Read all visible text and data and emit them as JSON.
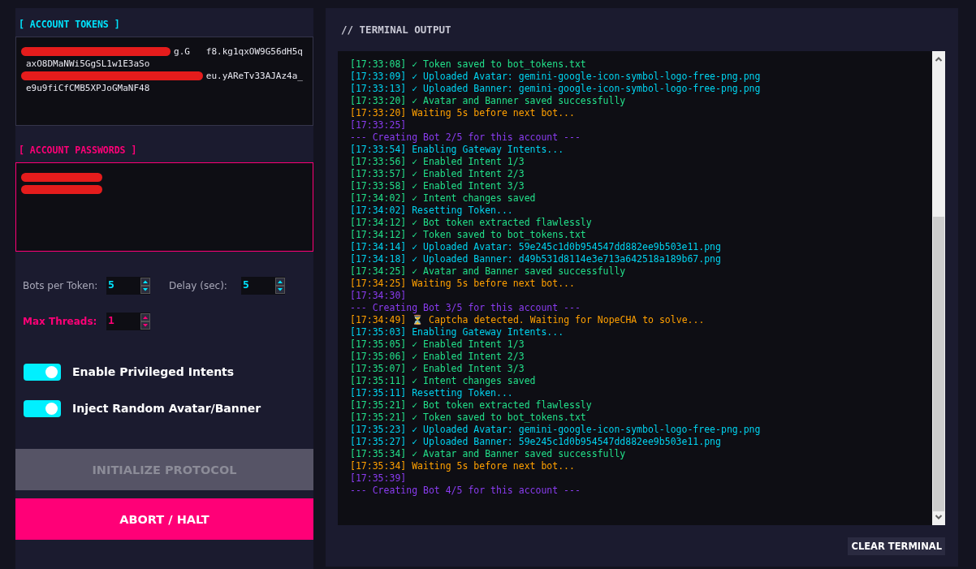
{
  "tokens": {
    "label": "[ ACCOUNT TOKENS ]",
    "lines": [
      {
        "text": "g.G   f8.kg1qxOW9G56dH5q",
        "redacted": true
      },
      {
        "text": "axO8DMaNWi5GgSL1w1E3aSo",
        "redacted": false
      },
      {
        "text": "eu.yAReTv33AJAz4a_",
        "redacted": true
      },
      {
        "text": "e9u9fiCfCMB5XPJoGMaNF48",
        "redacted": false
      }
    ]
  },
  "passwords": {
    "label": "[ ACCOUNT PASSWORDS ]",
    "lines": [
      {
        "redacted": true
      },
      {
        "redacted": true
      }
    ]
  },
  "settings": [
    {
      "label": "Bots per Token:",
      "value": "5",
      "kind": "normal"
    },
    {
      "label": "Delay (sec):",
      "value": "5",
      "kind": "normal"
    },
    {
      "label": "Max Threads:",
      "value": "1",
      "kind": "accent"
    }
  ],
  "toggles": [
    {
      "label": "Enable Privileged Intents",
      "on": true
    },
    {
      "label": "Inject Random Avatar/Banner",
      "on": true
    }
  ],
  "buttons": [
    {
      "label": "INITIALIZE PROTOCOL",
      "kind": "primary",
      "disabled": true
    },
    {
      "label": "ABORT / HALT",
      "kind": "danger",
      "disabled": false
    }
  ],
  "terminal": {
    "title": "// TERMINAL OUTPUT",
    "lines": [
      {
        "kind": "success",
        "time": "[17:33:08]",
        "icon": "✓",
        "text": "Token saved to bot_tokens.txt"
      },
      {
        "kind": "info",
        "time": "[17:33:09]",
        "icon": "✓",
        "text": "Uploaded Avatar: gemini-google-icon-symbol-logo-free-png.png"
      },
      {
        "kind": "info",
        "time": "[17:33:13]",
        "icon": "✓",
        "text": "Uploaded Banner: gemini-google-icon-symbol-logo-free-png.png"
      },
      {
        "kind": "success",
        "time": "[17:33:20]",
        "icon": "✓",
        "text": "Avatar and Banner saved successfully"
      },
      {
        "kind": "warn",
        "time": "[17:33:20]",
        "text": "Waiting 5s before next bot..."
      },
      {
        "kind": "stamp",
        "time": "[17:33:25]"
      },
      {
        "kind": "stamp",
        "text": "--- Creating Bot 2/5 for this account ---"
      },
      {
        "kind": "info",
        "time": "[17:33:54]",
        "text": "Enabling Gateway Intents..."
      },
      {
        "kind": "success",
        "time": "[17:33:56]",
        "icon": "✓",
        "text": "Enabled Intent 1/3"
      },
      {
        "kind": "success",
        "time": "[17:33:57]",
        "icon": "✓",
        "text": "Enabled Intent 2/3"
      },
      {
        "kind": "success",
        "time": "[17:33:58]",
        "icon": "✓",
        "text": "Enabled Intent 3/3"
      },
      {
        "kind": "success",
        "time": "[17:34:02]",
        "icon": "✓",
        "text": "Intent changes saved"
      },
      {
        "kind": "info",
        "time": "[17:34:02]",
        "text": "Resetting Token..."
      },
      {
        "kind": "success",
        "time": "[17:34:12]",
        "icon": "✓",
        "text": "Bot token extracted flawlessly"
      },
      {
        "kind": "success",
        "time": "[17:34:12]",
        "icon": "✓",
        "text": "Token saved to bot_tokens.txt"
      },
      {
        "kind": "info",
        "time": "[17:34:14]",
        "icon": "✓",
        "text": "Uploaded Avatar: 59e245c1d0b954547dd882ee9b503e11.png"
      },
      {
        "kind": "info",
        "time": "[17:34:18]",
        "icon": "✓",
        "text": "Uploaded Banner: d49b531d8114e3e713a642518a189b67.png"
      },
      {
        "kind": "success",
        "time": "[17:34:25]",
        "icon": "✓",
        "text": "Avatar and Banner saved successfully"
      },
      {
        "kind": "warn",
        "time": "[17:34:25]",
        "text": "Waiting 5s before next bot..."
      },
      {
        "kind": "stamp",
        "time": "[17:34:30]"
      },
      {
        "kind": "stamp",
        "text": "--- Creating Bot 3/5 for this account ---"
      },
      {
        "kind": "warn",
        "time": "[17:34:49]",
        "icon": "⏳",
        "text": "Captcha detected. Waiting for NopeCHA to solve..."
      },
      {
        "kind": "info",
        "time": "[17:35:03]",
        "text": "Enabling Gateway Intents..."
      },
      {
        "kind": "success",
        "time": "[17:35:05]",
        "icon": "✓",
        "text": "Enabled Intent 1/3"
      },
      {
        "kind": "success",
        "time": "[17:35:06]",
        "icon": "✓",
        "text": "Enabled Intent 2/3"
      },
      {
        "kind": "success",
        "time": "[17:35:07]",
        "icon": "✓",
        "text": "Enabled Intent 3/3"
      },
      {
        "kind": "success",
        "time": "[17:35:11]",
        "icon": "✓",
        "text": "Intent changes saved"
      },
      {
        "kind": "info",
        "time": "[17:35:11]",
        "text": "Resetting Token..."
      },
      {
        "kind": "success",
        "time": "[17:35:21]",
        "icon": "✓",
        "text": "Bot token extracted flawlessly"
      },
      {
        "kind": "success",
        "time": "[17:35:21]",
        "icon": "✓",
        "text": "Token saved to bot_tokens.txt"
      },
      {
        "kind": "info",
        "time": "[17:35:23]",
        "icon": "✓",
        "text": "Uploaded Avatar: gemini-google-icon-symbol-logo-free-png.png"
      },
      {
        "kind": "info",
        "time": "[17:35:27]",
        "icon": "✓",
        "text": "Uploaded Banner: 59e245c1d0b954547dd882ee9b503e11.png"
      },
      {
        "kind": "success",
        "time": "[17:35:34]",
        "icon": "✓",
        "text": "Avatar and Banner saved successfully"
      },
      {
        "kind": "warn",
        "time": "[17:35:34]",
        "text": "Waiting 5s before next bot..."
      },
      {
        "kind": "stamp",
        "time": "[17:35:39]"
      },
      {
        "kind": "stamp",
        "text": "--- Creating Bot 4/5 for this account ---"
      }
    ],
    "clear_button": "CLEAR TERMINAL"
  }
}
